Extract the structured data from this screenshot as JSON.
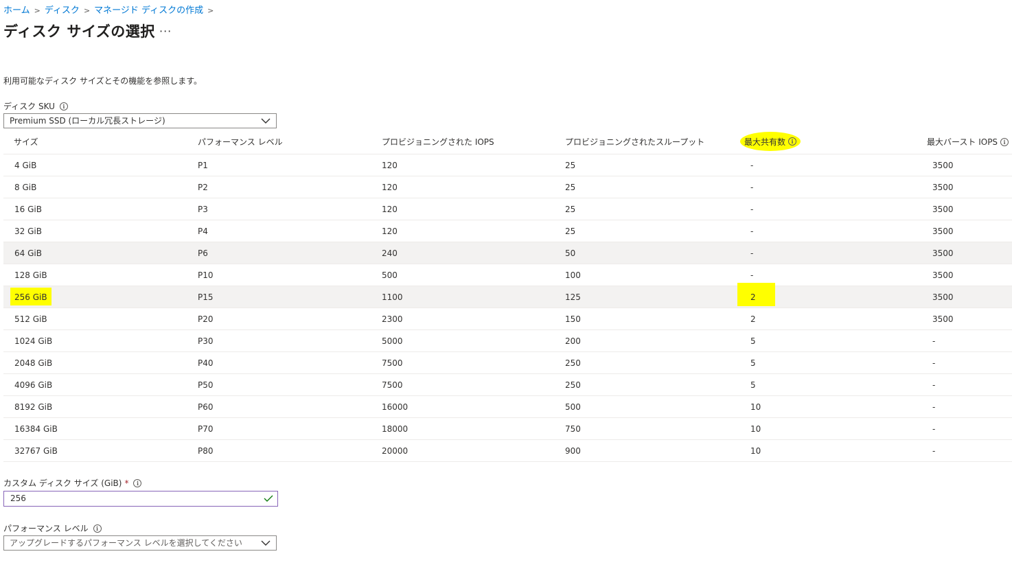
{
  "breadcrumb": {
    "items": [
      "ホーム",
      "ディスク",
      "マネージド ディスクの作成"
    ]
  },
  "page": {
    "title": "ディスク サイズの選択",
    "more": "···"
  },
  "description": "利用可能なディスク サイズとその機能を参照します。",
  "sku": {
    "label": "ディスク SKU",
    "value": "Premium SSD (ローカル冗長ストレージ)"
  },
  "table": {
    "headers": [
      "サイズ",
      "パフォーマンス レベル",
      "プロビジョニングされた IOPS",
      "プロビジョニングされたスループット",
      "最大共有数",
      "最大バースト IOPS"
    ],
    "rows": [
      [
        "4 GiB",
        "P1",
        "120",
        "25",
        "-",
        "3500"
      ],
      [
        "8 GiB",
        "P2",
        "120",
        "25",
        "-",
        "3500"
      ],
      [
        "16 GiB",
        "P3",
        "120",
        "25",
        "-",
        "3500"
      ],
      [
        "32 GiB",
        "P4",
        "120",
        "25",
        "-",
        "3500"
      ],
      [
        "64 GiB",
        "P6",
        "240",
        "50",
        "-",
        "3500"
      ],
      [
        "128 GiB",
        "P10",
        "500",
        "100",
        "-",
        "3500"
      ],
      [
        "256 GiB",
        "P15",
        "1100",
        "125",
        "2",
        "3500"
      ],
      [
        "512 GiB",
        "P20",
        "2300",
        "150",
        "2",
        "3500"
      ],
      [
        "1024 GiB",
        "P30",
        "5000",
        "200",
        "5",
        "-"
      ],
      [
        "2048 GiB",
        "P40",
        "7500",
        "250",
        "5",
        "-"
      ],
      [
        "4096 GiB",
        "P50",
        "7500",
        "250",
        "5",
        "-"
      ],
      [
        "8192 GiB",
        "P60",
        "16000",
        "500",
        "10",
        "-"
      ],
      [
        "16384 GiB",
        "P70",
        "18000",
        "750",
        "10",
        "-"
      ],
      [
        "32767 GiB",
        "P80",
        "20000",
        "900",
        "10",
        "-"
      ]
    ]
  },
  "custom_size": {
    "label": "カスタム ディスク サイズ (GiB)",
    "required": "*",
    "value": "256"
  },
  "perf_level": {
    "label": "パフォーマンス レベル",
    "placeholder": "アップグレードするパフォーマンス レベルを選択してください"
  },
  "colors": {
    "link": "#0078d4",
    "highlight": "#ffff00",
    "focus_border": "#8764b8",
    "check": "#107c10"
  }
}
